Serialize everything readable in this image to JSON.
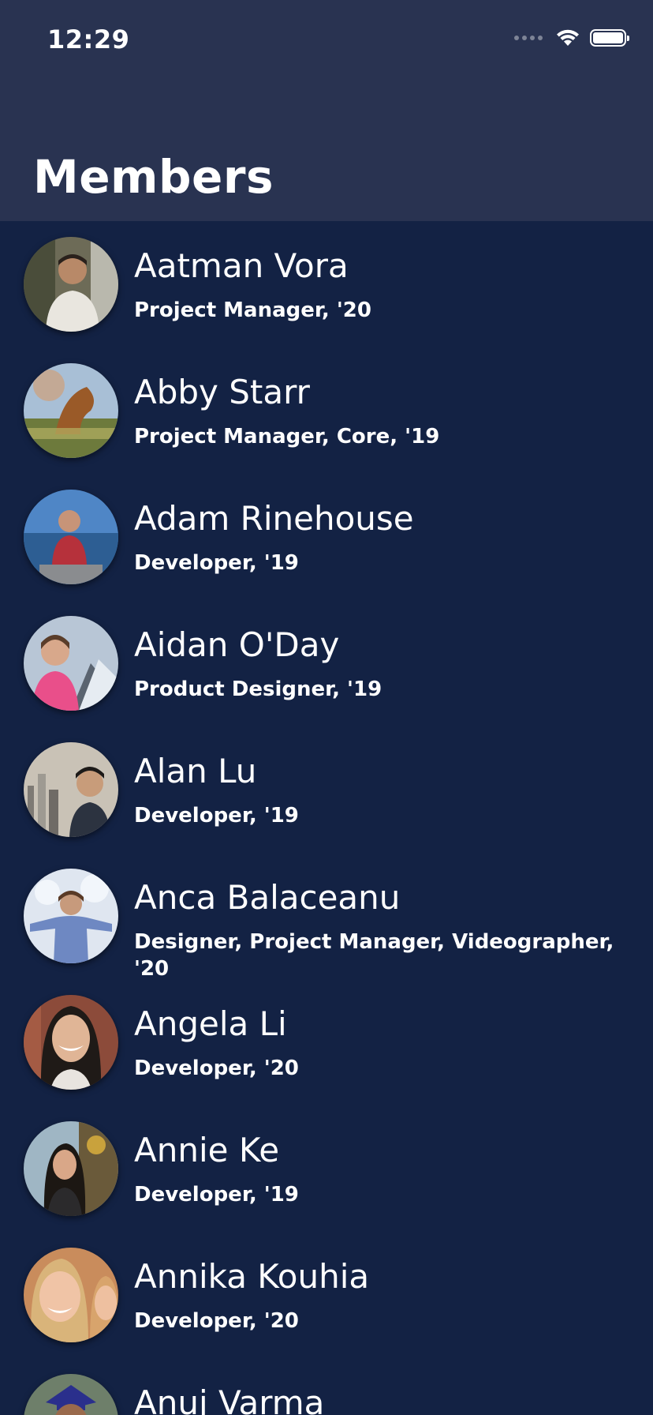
{
  "status_bar": {
    "time": "12:29",
    "icons": [
      "cellular-signal-icon",
      "wifi-icon",
      "battery-icon"
    ]
  },
  "header": {
    "title": "Members"
  },
  "colors": {
    "background": "#132244",
    "header_background": "#293351",
    "text": "#ffffff"
  },
  "members": [
    {
      "name": "Aatman Vora",
      "role": "Project Manager, '20"
    },
    {
      "name": "Abby Starr",
      "role": "Project Manager, Core, '19"
    },
    {
      "name": "Adam Rinehouse",
      "role": "Developer, '19"
    },
    {
      "name": "Aidan O'Day",
      "role": "Product Designer, '19"
    },
    {
      "name": "Alan Lu",
      "role": "Developer, '19"
    },
    {
      "name": "Anca Balaceanu",
      "role": "Designer, Project Manager, Videographer, '20"
    },
    {
      "name": "Angela Li",
      "role": "Developer, '20"
    },
    {
      "name": "Annie Ke",
      "role": "Developer, '19"
    },
    {
      "name": "Annika Kouhia",
      "role": "Developer, '20"
    },
    {
      "name": "Anuj Varma",
      "role": ""
    }
  ]
}
